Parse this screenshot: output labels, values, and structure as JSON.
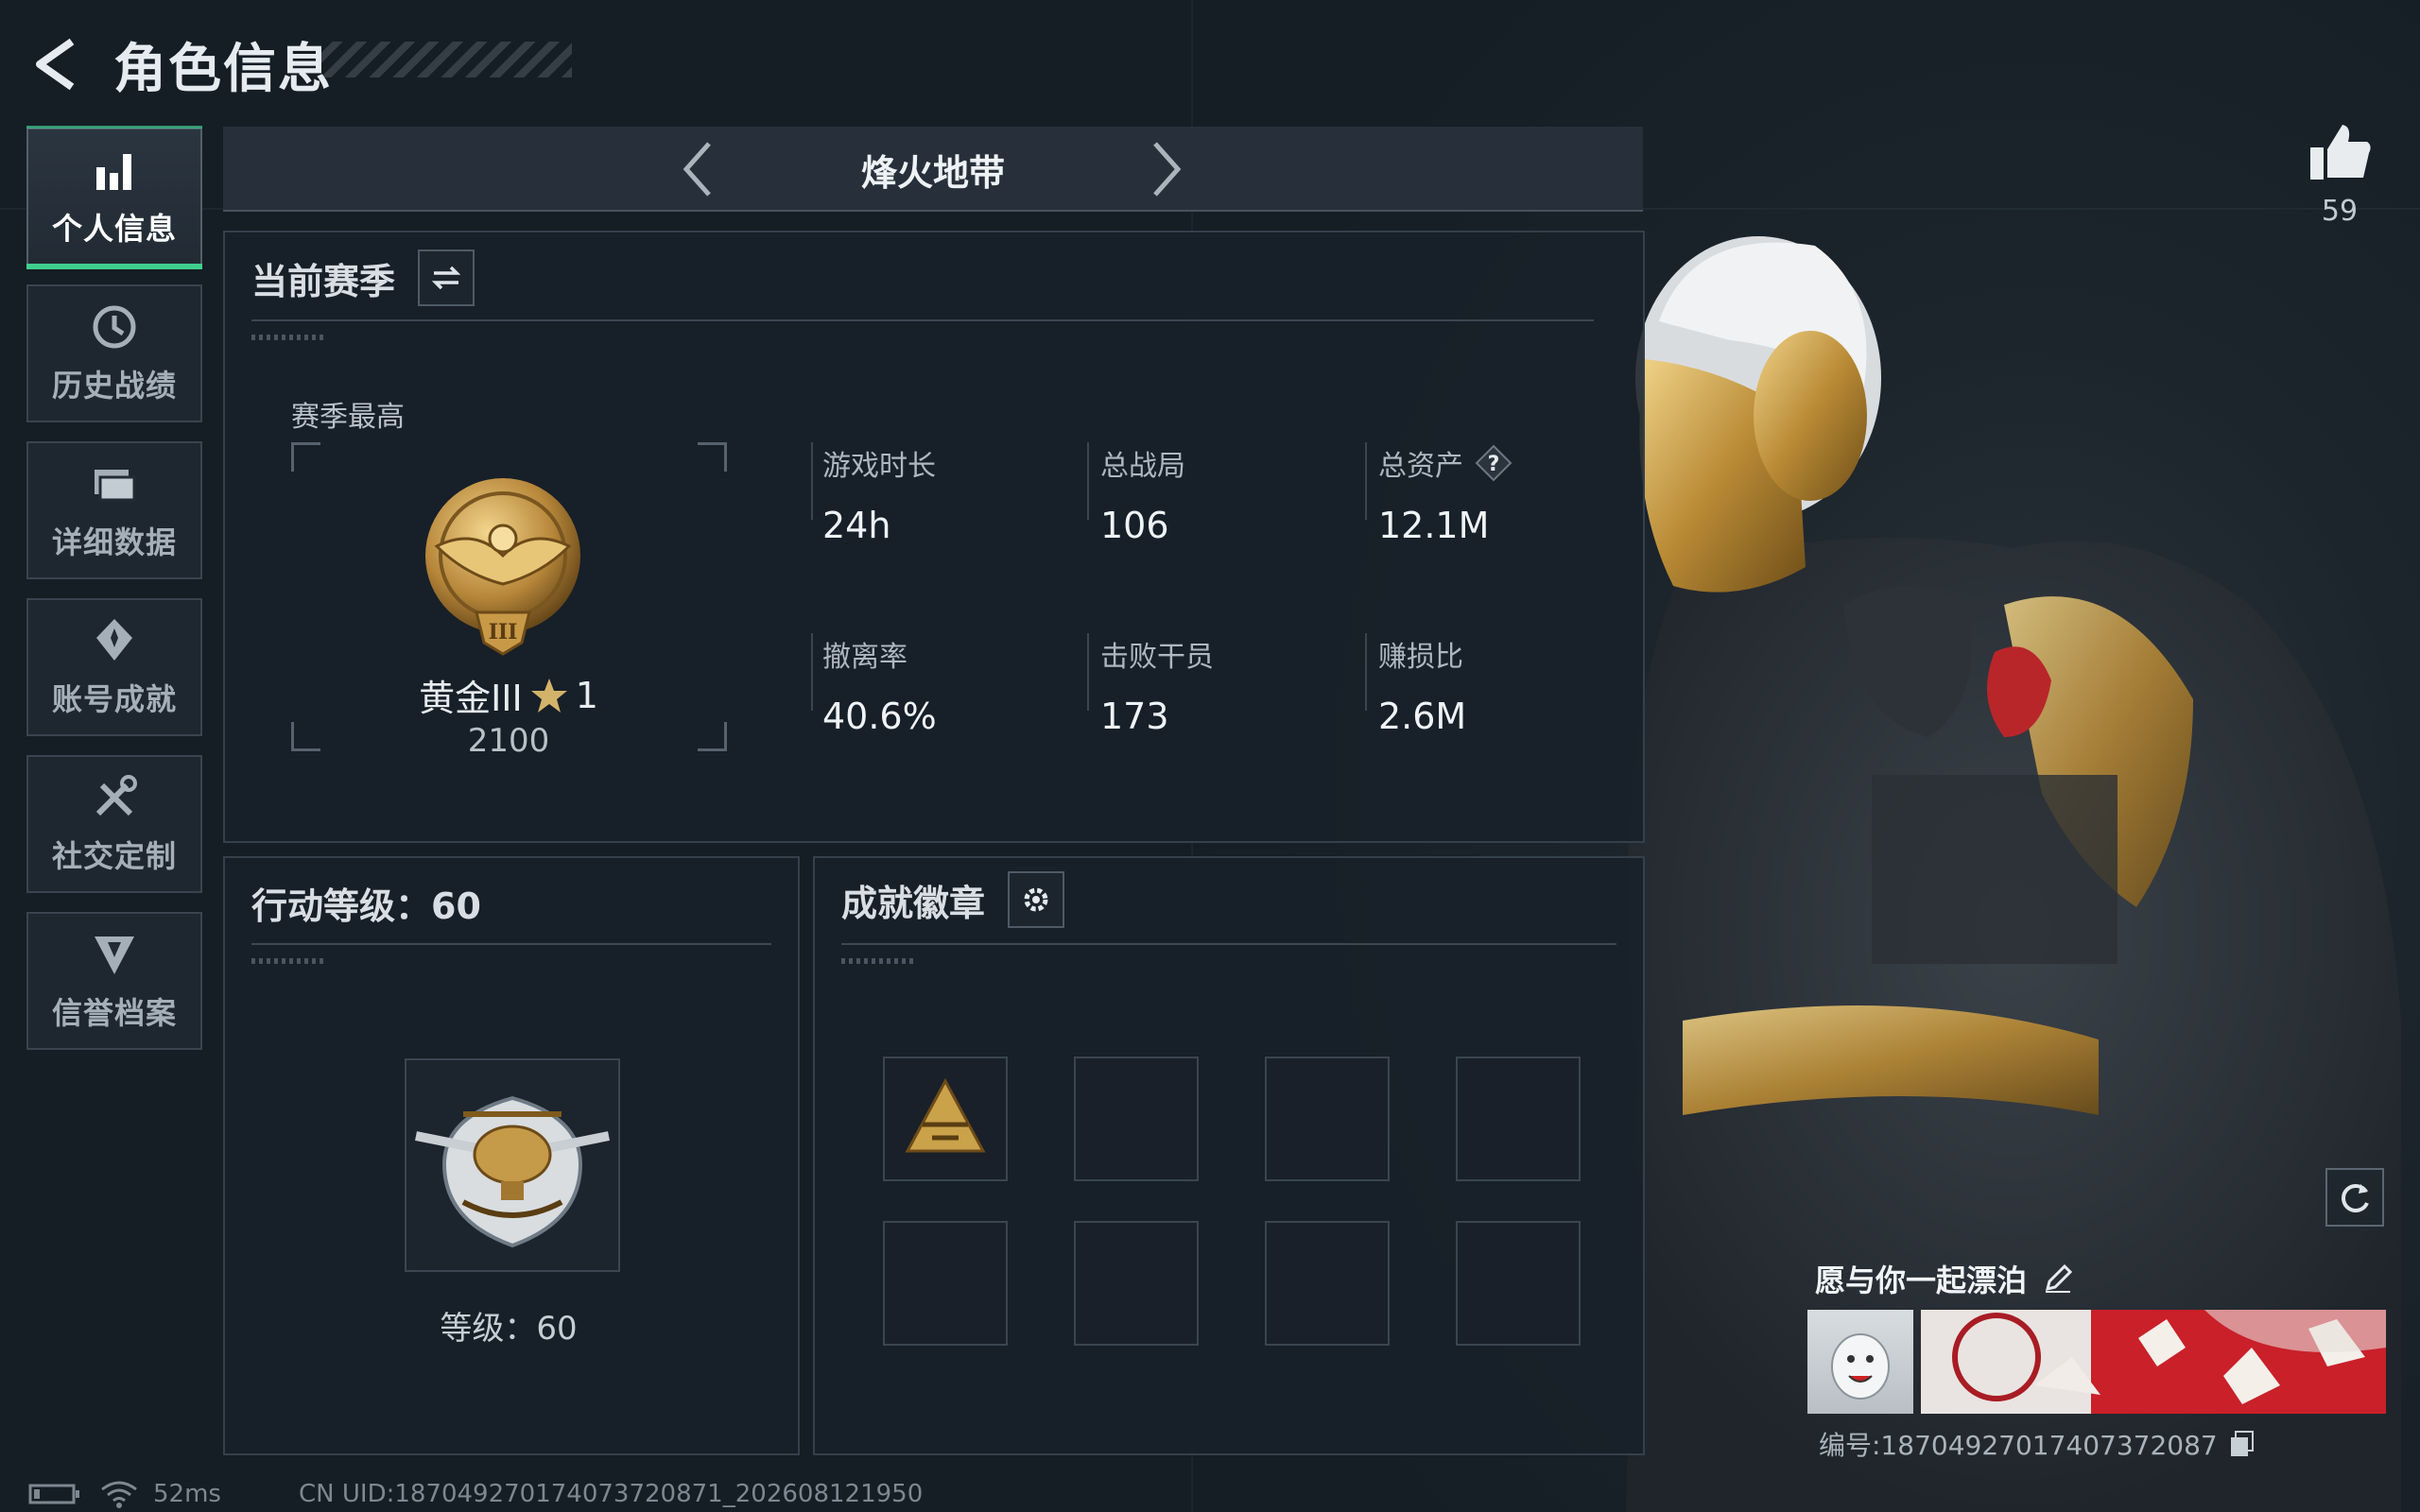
{
  "header": {
    "title": "角色信息",
    "back_icon": "back-arrow-icon"
  },
  "sidebar": {
    "items": [
      {
        "label": "个人信息",
        "icon": "bar-chart-icon",
        "active": true
      },
      {
        "label": "历史战绩",
        "icon": "history-clock-icon",
        "active": false
      },
      {
        "label": "详细数据",
        "icon": "folder-icon",
        "active": false
      },
      {
        "label": "账号成就",
        "icon": "achievement-icon",
        "active": false
      },
      {
        "label": "社交定制",
        "icon": "tools-icon",
        "active": false
      },
      {
        "label": "信誉档案",
        "icon": "credit-shield-icon",
        "active": false
      }
    ]
  },
  "mode": {
    "title": "烽火地带",
    "prev_icon": "chevron-left-icon",
    "next_icon": "chevron-right-icon"
  },
  "season": {
    "title": "当前赛季",
    "switch_icon": "swap-icon",
    "best_label": "赛季最高",
    "rank_name": "黄金III",
    "rank_stars": "1",
    "rank_score": "2100",
    "stats": [
      {
        "label": "游戏时长",
        "value": "24h"
      },
      {
        "label": "总战局",
        "value": "106"
      },
      {
        "label": "总资产",
        "value": "12.1M",
        "help": true
      },
      {
        "label": "撤离率",
        "value": "40.6%"
      },
      {
        "label": "击败干员",
        "value": "173"
      },
      {
        "label": "赚损比",
        "value": "2.6M"
      }
    ]
  },
  "level": {
    "title": "行动等级：60",
    "level_text": "等级：60"
  },
  "badges": {
    "title": "成就徽章",
    "settings_icon": "gear-icon",
    "filled_slot_icon": "gold-triangle-badge-icon"
  },
  "profile": {
    "likes": "59",
    "nickname": "愿与你一起漂泊",
    "edit_icon": "pencil-icon",
    "player_id": "编号:18704927017407372087",
    "copy_icon": "copy-icon",
    "refresh_icon": "refresh-icon"
  },
  "status": {
    "ping": "52ms",
    "uid": "CN UID:18704927017407372087​1_202608121950"
  },
  "colors": {
    "accent": "#3ecf8e",
    "gold": "#c9a24a",
    "panel": "#182029"
  }
}
